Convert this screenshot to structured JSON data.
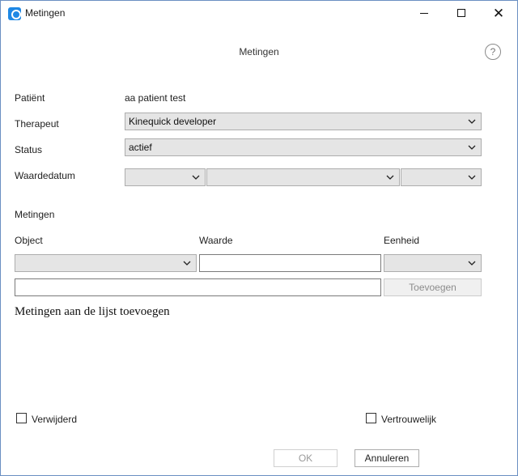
{
  "window": {
    "title": "Metingen"
  },
  "header": {
    "title": "Metingen",
    "help_symbol": "?"
  },
  "form": {
    "patient_label": "Patiënt",
    "patient_value": "aa patient test",
    "therapist_label": "Therapeut",
    "therapist_value": "Kinequick developer",
    "status_label": "Status",
    "status_value": "actief",
    "date_label": "Waardedatum",
    "date_day": "",
    "date_month": "",
    "date_year": ""
  },
  "measurements": {
    "section_label": "Metingen",
    "col_object": "Object",
    "col_value": "Waarde",
    "col_unit": "Eenheid",
    "object_value": "",
    "value_value": "",
    "unit_value": "",
    "note_value": "",
    "add_button": "Toevoegen",
    "empty_message": "Metingen aan de lijst toevoegen"
  },
  "options": {
    "deleted_label": "Verwijderd",
    "deleted_checked": false,
    "confidential_label": "Vertrouwelijk",
    "confidential_checked": false
  },
  "footer": {
    "ok_label": "OK",
    "cancel_label": "Annuleren"
  },
  "icons": {
    "app": "app-logo-icon",
    "help": "help-icon",
    "dropdown": "chevron-down-icon"
  },
  "colors": {
    "window_border": "#6b8fc2",
    "app_icon": "#1e88e5",
    "select_bg": "#e5e5e5"
  }
}
